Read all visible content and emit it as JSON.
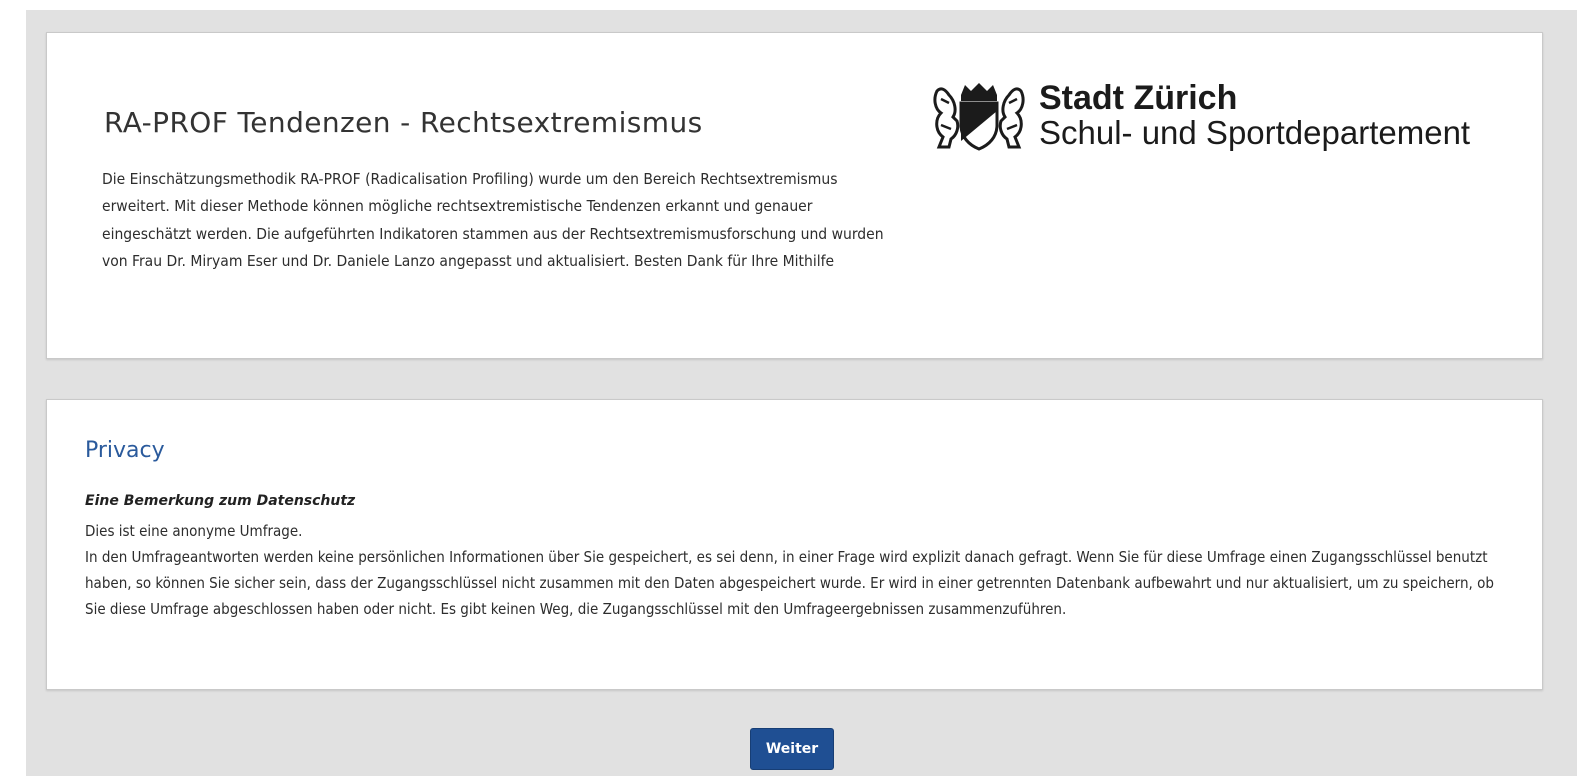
{
  "survey": {
    "title": "RA-PROF Tendenzen - Rechtsextremismus",
    "description": "Die Einschätzungsmethodik RA-PROF (Radicalisation Profiling) wurde um den Bereich Rechtsextremismus erweitert. Mit dieser Methode können mögliche rechtsextremistische Tendenzen erkannt und genauer eingeschätzt werden. Die aufgeführten Indikatoren stammen aus der Rechtsextremismusforschung und wurden von Frau Dr. Miryam Eser und Dr. Daniele Lanzo angepasst und aktualisiert. Besten Dank für Ihre Mithilfe"
  },
  "logo": {
    "icon": "zurich-coat-of-arms-icon",
    "line1": "Stadt Zürich",
    "line2": "Schul- und Sportdepartement"
  },
  "privacy": {
    "title": "Privacy",
    "subtitle": "Eine Bemerkung zum Datenschutz",
    "paragraphs": [
      "Dies ist eine anonyme Umfrage.",
      "In den Umfrageantworten werden keine persönlichen Informationen über Sie gespeichert, es sei denn, in einer Frage wird explizit danach gefragt. Wenn Sie für diese Umfrage einen Zugangsschlüssel benutzt haben, so können Sie sicher sein, dass der Zugangsschlüssel nicht zusammen mit den Daten abgespeichert wurde. Er wird in einer getrennten Datenbank aufbewahrt und nur aktualisiert, um zu speichern, ob Sie diese Umfrage abgeschlossen haben oder nicht. Es gibt keinen Weg, die Zugangsschlüssel mit den Umfrageergebnissen zusammenzuführen."
    ]
  },
  "buttons": {
    "next": "Weiter"
  },
  "colors": {
    "background": "#e1e1e1",
    "accent": "#1f4f93",
    "privacy_title": "#2a5a9c"
  }
}
